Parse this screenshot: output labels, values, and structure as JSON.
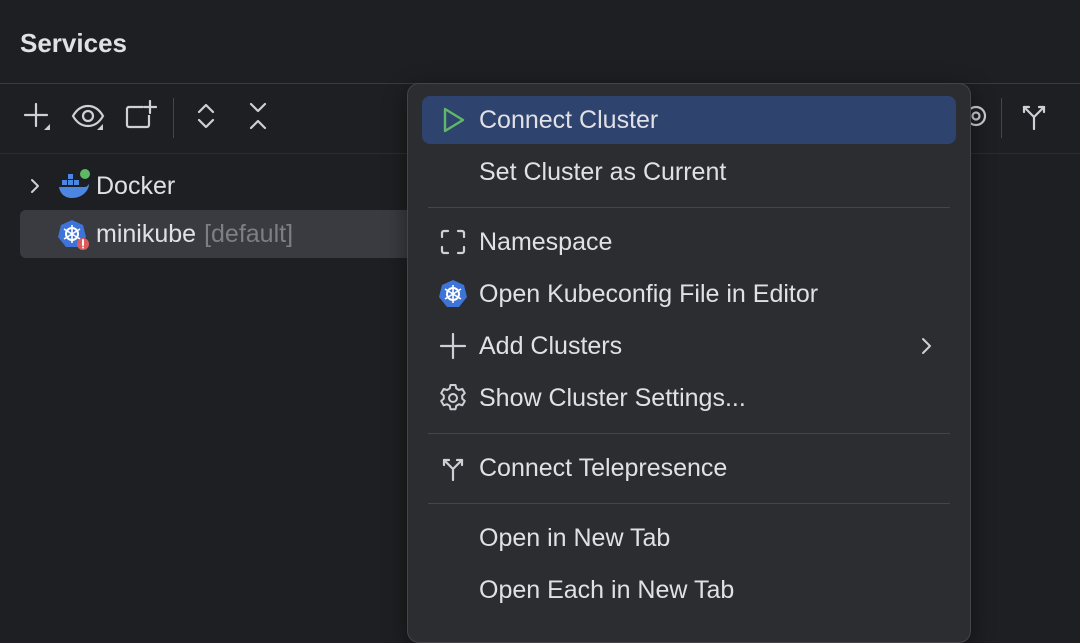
{
  "panel": {
    "title": "Services"
  },
  "toolbar": {
    "icons": [
      "add-icon",
      "eye-icon",
      "new-tab-icon",
      "expand-all-icon",
      "collapse-all-icon",
      "settings-icon",
      "telepresence-icon"
    ]
  },
  "tree": {
    "items": [
      {
        "label": "Docker",
        "hint": "",
        "icon": "docker-icon",
        "expanded": false
      },
      {
        "label": "minikube",
        "hint": "[default]",
        "icon": "kubernetes-icon",
        "selected": true
      }
    ]
  },
  "context_menu": {
    "items": [
      {
        "label": "Connect Cluster",
        "icon": "run-icon",
        "active": true
      },
      {
        "label": "Set Cluster as Current",
        "icon": ""
      },
      {
        "label": "Namespace",
        "icon": "namespace-icon"
      },
      {
        "label": "Open Kubeconfig File in Editor",
        "icon": "kubernetes-icon"
      },
      {
        "label": "Add Clusters",
        "icon": "plus-icon",
        "submenu": true
      },
      {
        "label": "Show Cluster Settings...",
        "icon": "gear-icon"
      },
      {
        "label": "Connect Telepresence",
        "icon": "telepresence-icon"
      },
      {
        "label": "Open in New Tab",
        "icon": ""
      },
      {
        "label": "Open Each in New Tab",
        "icon": ""
      }
    ]
  },
  "colors": {
    "background": "#1e1f22",
    "menu_background": "#2b2d30",
    "menu_active": "#2e436e",
    "run_green": "#5fb865",
    "kubernetes_blue": "#3e73d8",
    "docker_blue": "#4b86e0",
    "error_red": "#db5c5c",
    "online_green": "#5fb865"
  }
}
